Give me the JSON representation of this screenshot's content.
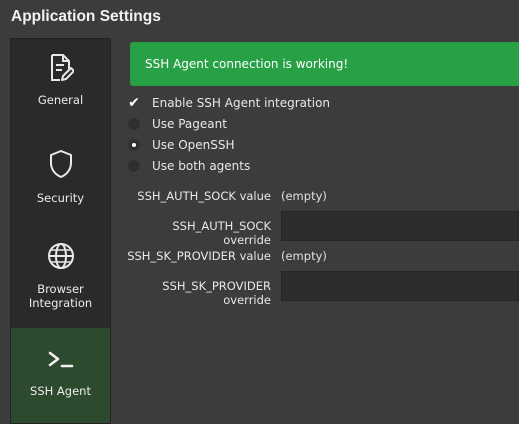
{
  "window": {
    "title": "Application Settings"
  },
  "sidebar": {
    "items": [
      {
        "label": "General",
        "icon": "document-edit-icon",
        "active": false
      },
      {
        "label": "Security",
        "icon": "shield-icon",
        "active": false
      },
      {
        "label": "Browser Integration",
        "icon": "globe-icon",
        "active": false
      },
      {
        "label": "SSH Agent",
        "icon": "terminal-prompt-icon",
        "active": true
      }
    ]
  },
  "banner": {
    "text": "SSH Agent connection is working!",
    "color": "#27a046"
  },
  "options": {
    "enable_label": "Enable SSH Agent integration",
    "enable_checked": true,
    "radios": [
      {
        "label": "Use Pageant",
        "checked": false
      },
      {
        "label": "Use OpenSSH",
        "checked": true
      },
      {
        "label": "Use both agents",
        "checked": false
      }
    ]
  },
  "fields": {
    "auth_sock_value_label": "SSH_AUTH_SOCK value",
    "auth_sock_value": "(empty)",
    "auth_sock_override_label": "SSH_AUTH_SOCK override",
    "auth_sock_override_value": "",
    "sk_provider_value_label": "SSH_SK_PROVIDER value",
    "sk_provider_value": "(empty)",
    "sk_provider_override_label": "SSH_SK_PROVIDER override",
    "sk_provider_override_value": ""
  }
}
